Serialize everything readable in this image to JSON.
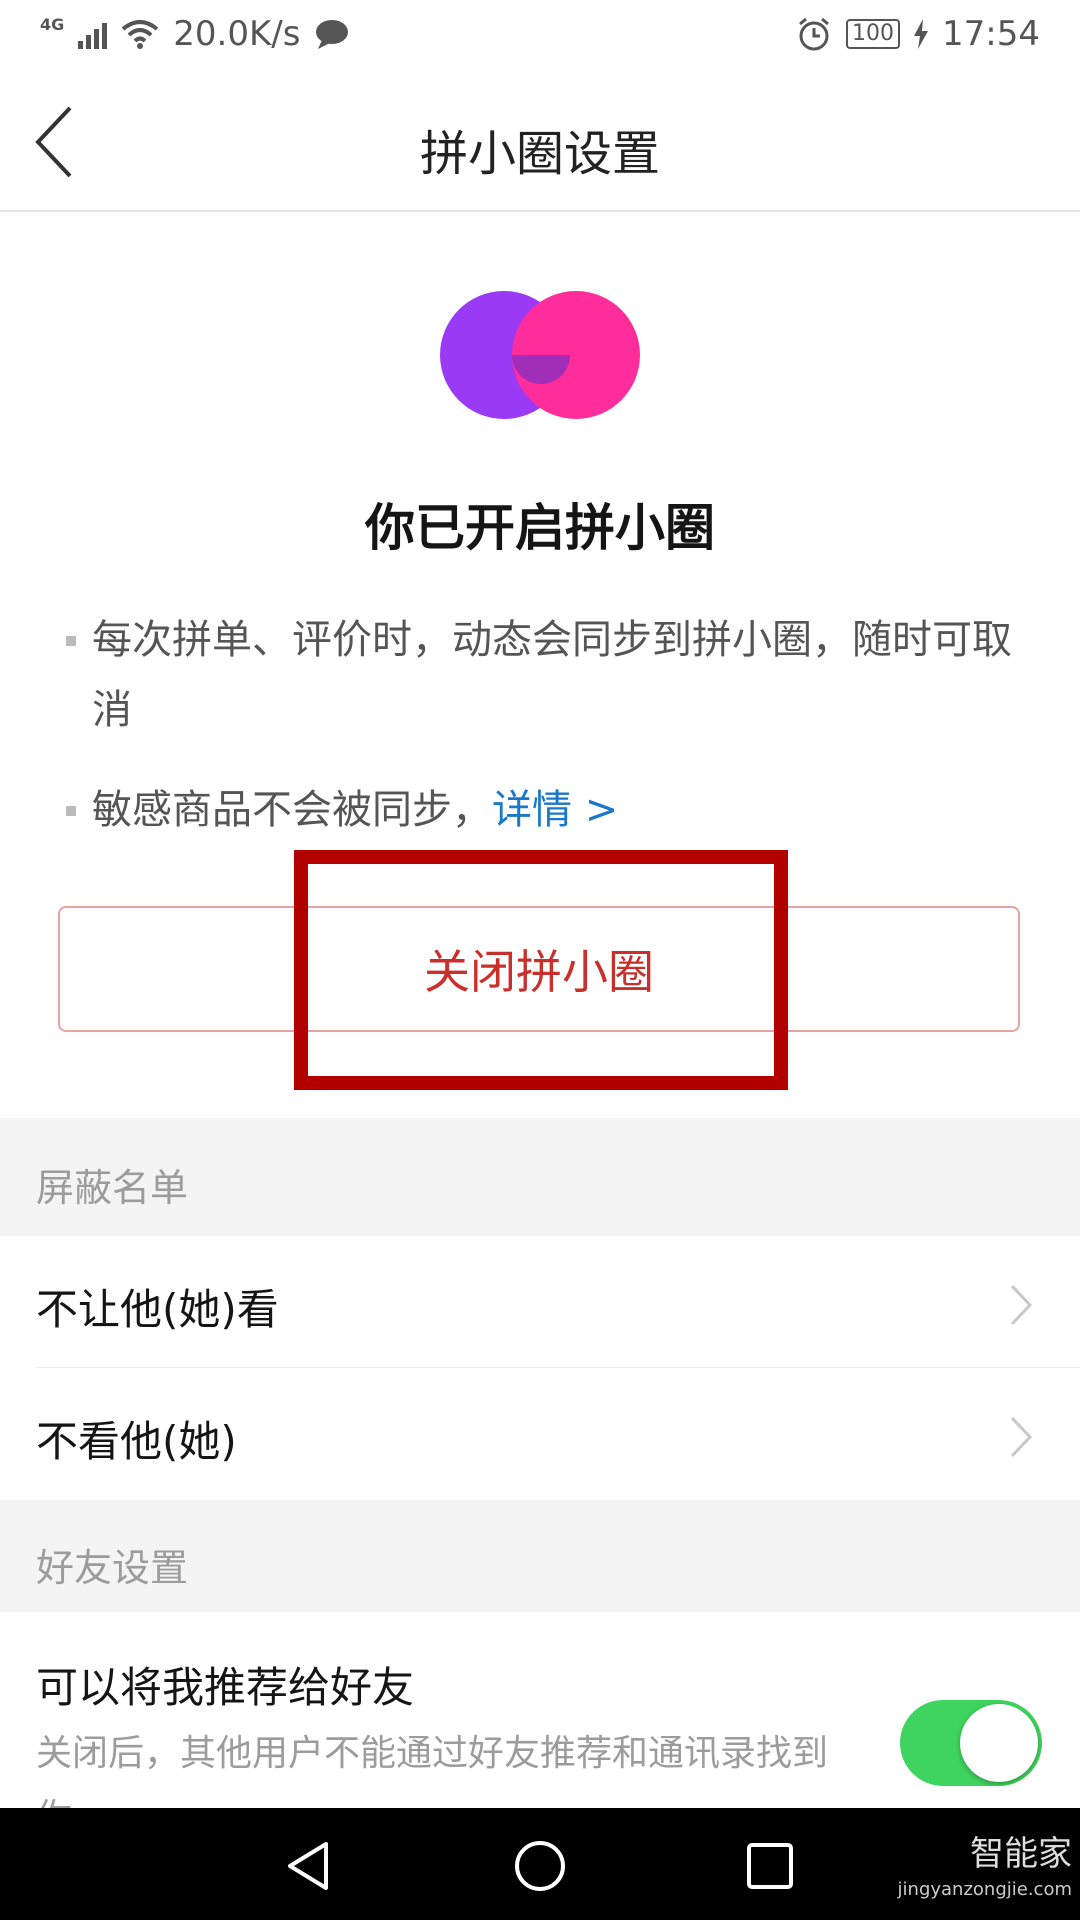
{
  "status_bar": {
    "network_type": "4G",
    "speed": "20.0K/s",
    "battery": "100",
    "time": "17:54"
  },
  "header": {
    "title": "拼小圈设置"
  },
  "hero": {
    "title": "你已开启拼小圈",
    "logo_colors": [
      "#9b3af5",
      "#ff2c9c"
    ],
    "bullet_1": "每次拼单、评价时，动态会同步到拼小圈，随时可取消",
    "bullet_2": "敏感商品不会被同步，",
    "details_link": "详情 >"
  },
  "close_button": {
    "label": "关闭拼小圈",
    "color": "#c9302c"
  },
  "block_list": {
    "header": "屏蔽名单",
    "items": [
      {
        "label": "不让他(她)看"
      },
      {
        "label": "不看他(她)"
      }
    ]
  },
  "friend_settings": {
    "header": "好友设置",
    "recommend_title": "可以将我推荐给好友",
    "recommend_desc": "关闭后，其他用户不能通过好友推荐和通讯录找到你",
    "recommend_enabled": true,
    "toggle_color": "#3fd45f"
  },
  "watermark": {
    "text": "智能家",
    "url": "jingyanzongjie.com"
  }
}
